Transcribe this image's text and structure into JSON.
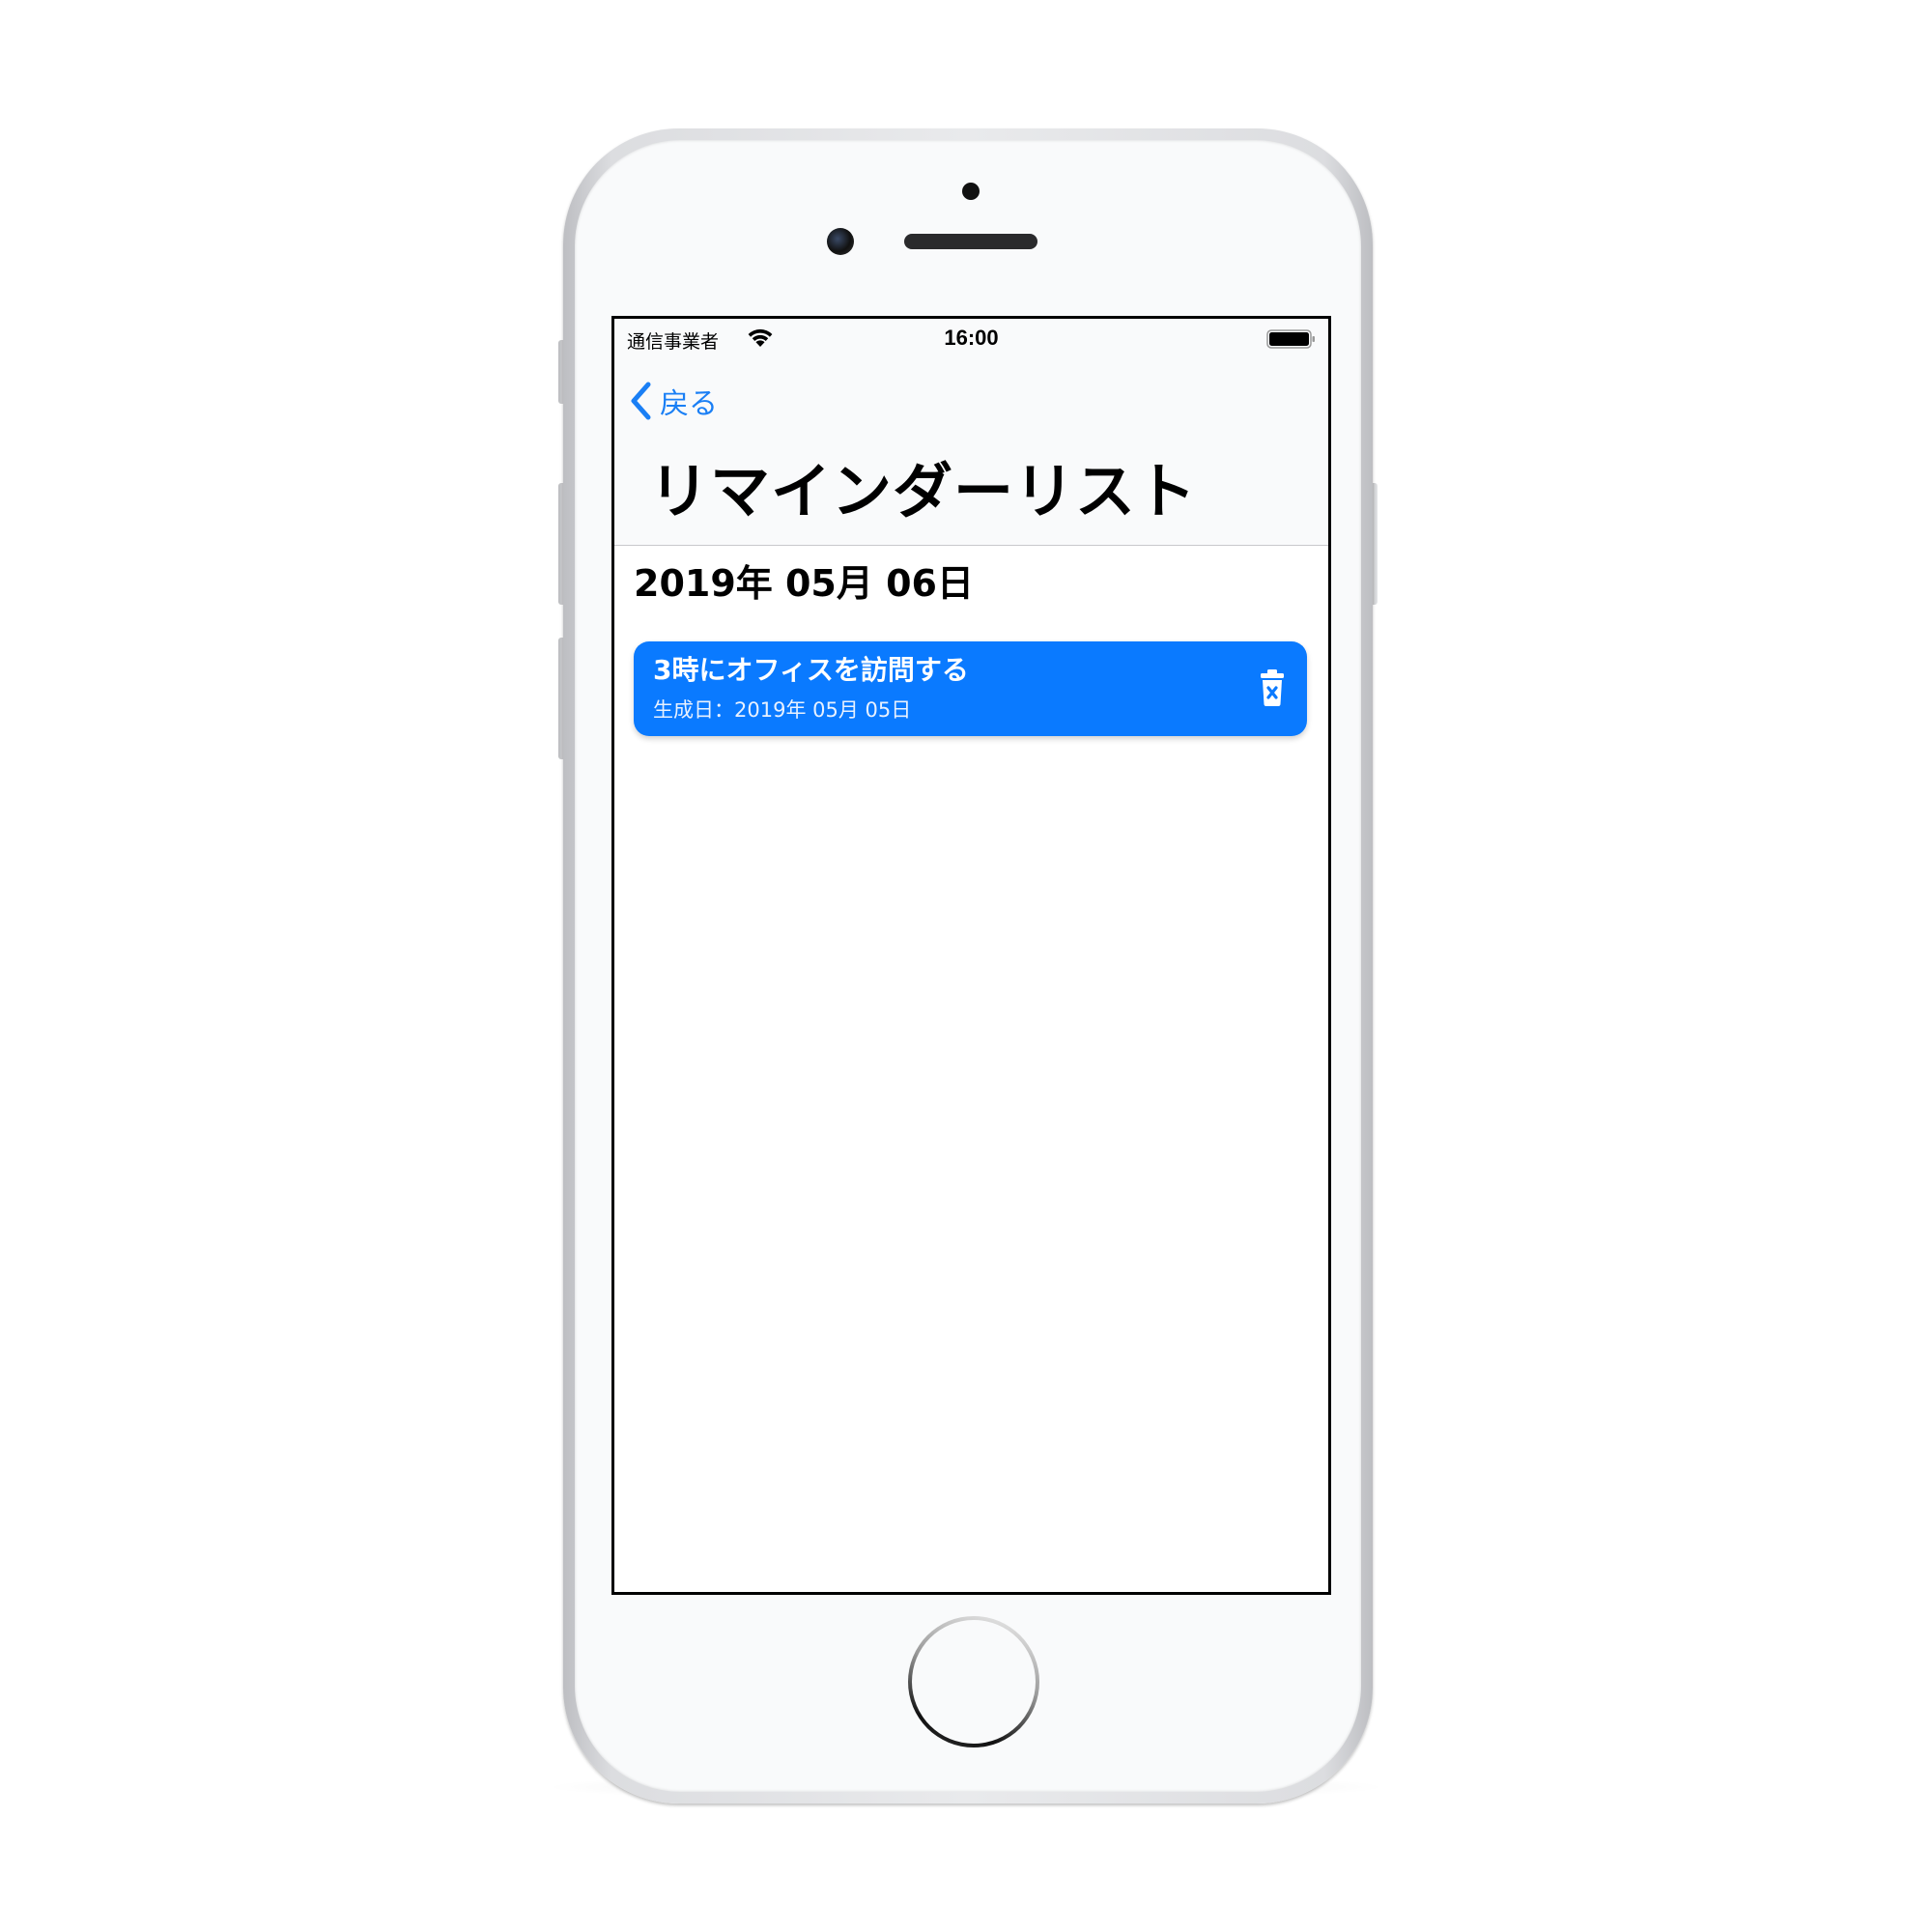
{
  "status_bar": {
    "carrier": "通信事業者",
    "time": "16:00",
    "wifi_icon": "wifi-icon",
    "battery_icon": "battery-icon"
  },
  "nav": {
    "back_label": "戻る",
    "back_icon": "chevron-left-icon",
    "title": "リマインダーリスト"
  },
  "section": {
    "date": "2019年 05月 06日"
  },
  "reminders": [
    {
      "title": "3時にオフィスを訪問する",
      "created_label": "生成日：",
      "created_date": "2019年 05月 05日",
      "delete_icon": "trash-icon"
    }
  ],
  "colors": {
    "accent": "#0a7aff",
    "back_tint": "#1a7ff5",
    "card_text": "#ffffff",
    "title_text": "#000000"
  }
}
